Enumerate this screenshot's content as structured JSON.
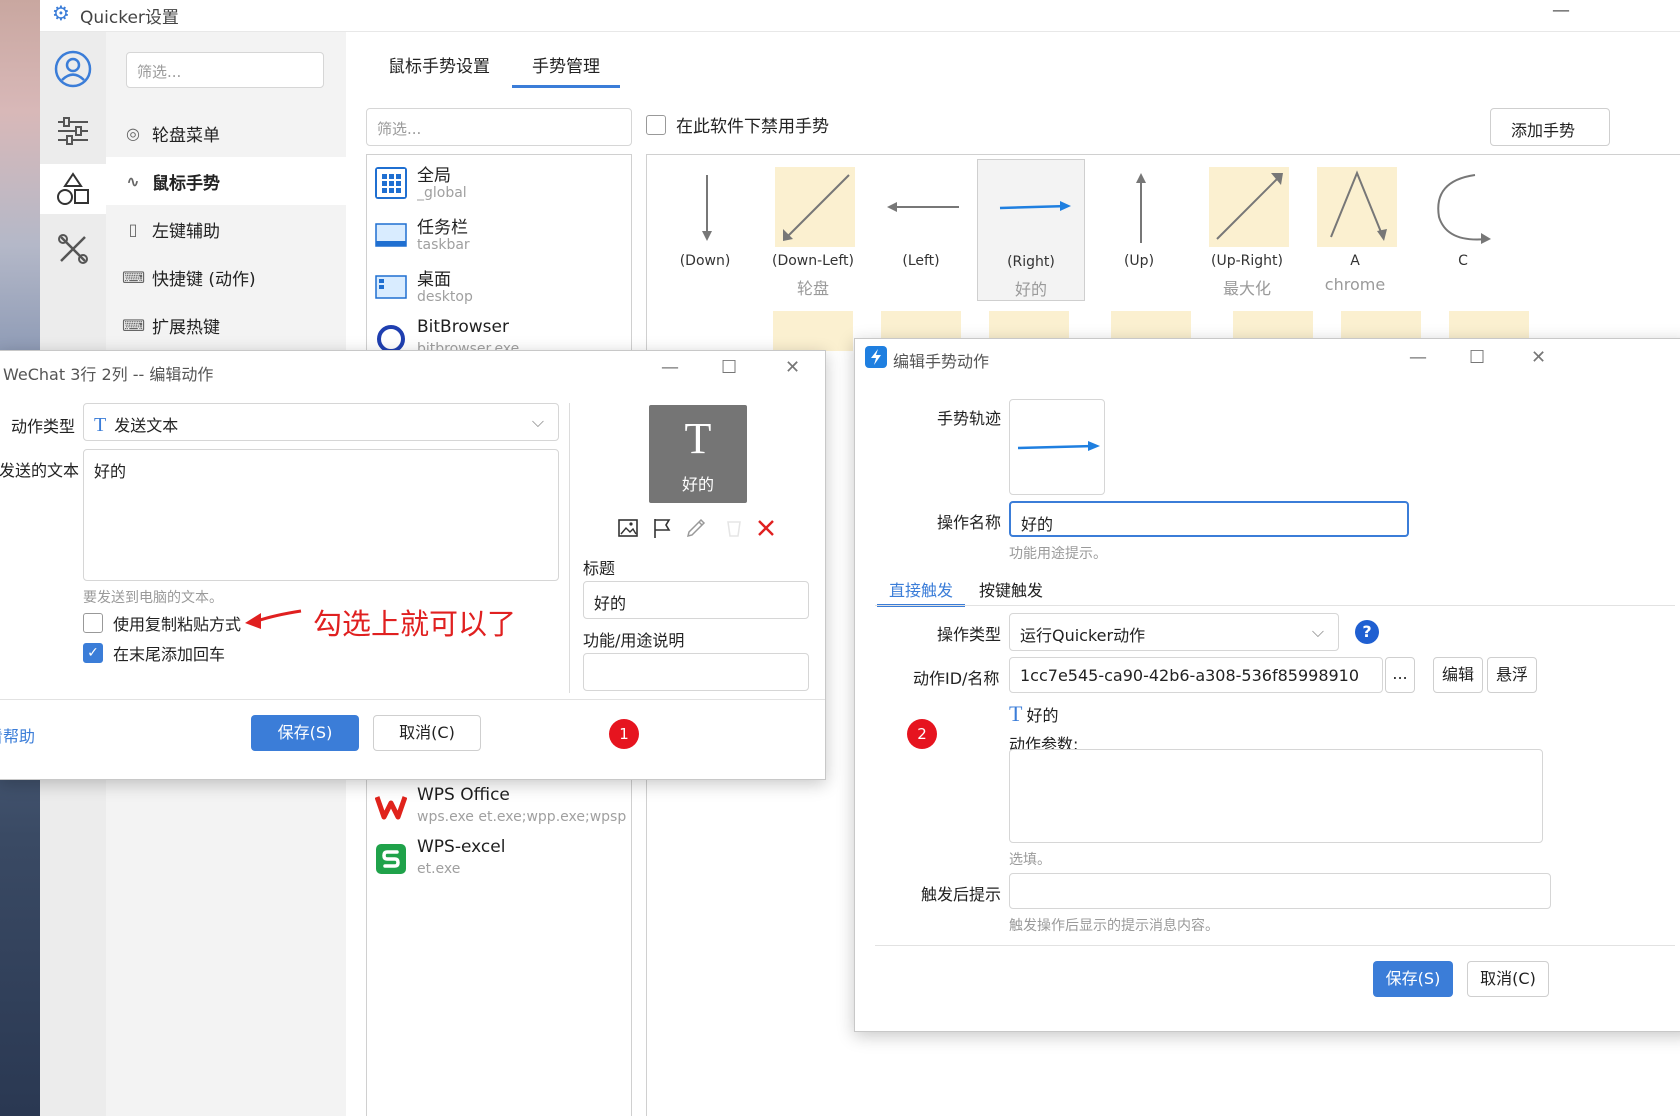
{
  "window": {
    "title": "Quicker设置",
    "minimize": "—"
  },
  "nav": {
    "filter_placeholder": "筛选...",
    "items": [
      {
        "label": "轮盘菜单",
        "icon": "wheel-icon"
      },
      {
        "label": "鼠标手势",
        "icon": "gesture-icon"
      },
      {
        "label": "左键辅助",
        "icon": "mouse-icon"
      },
      {
        "label": "快捷键 (动作)",
        "icon": "keyboard-icon"
      },
      {
        "label": "扩展热键",
        "icon": "keyboard-icon"
      }
    ]
  },
  "tabs": [
    {
      "label": "鼠标手势设置"
    },
    {
      "label": "手势管理"
    }
  ],
  "app_filter_placeholder": "筛选...",
  "disable_checkbox": "在此软件下禁用手势",
  "add_button": "添加手势",
  "apps": [
    {
      "name": "全局",
      "sub": "_global"
    },
    {
      "name": "任务栏",
      "sub": "taskbar"
    },
    {
      "name": "桌面",
      "sub": "desktop"
    },
    {
      "name": "BitBrowser",
      "sub": "bitbrowser.exe"
    },
    {
      "name": "WPS Office",
      "sub": "wps.exe  et.exe;wpp.exe;wpspdf.exe"
    },
    {
      "name": "WPS-excel",
      "sub": "et.exe"
    }
  ],
  "gestures": [
    {
      "name": "(Down)",
      "action": ""
    },
    {
      "name": "(Down-Left)",
      "action": "轮盘"
    },
    {
      "name": "(Left)",
      "action": ""
    },
    {
      "name": "(Right)",
      "action": "好的"
    },
    {
      "name": "(Up)",
      "action": ""
    },
    {
      "name": "(Up-Right)",
      "action": "最大化"
    },
    {
      "name": "A",
      "action": "chrome"
    },
    {
      "name": "C",
      "action": ""
    }
  ],
  "dialog1": {
    "title": "WeChat 3行 2列 -- 编辑动作",
    "action_type_label": "动作类型",
    "action_type_value": "发送文本",
    "send_text_label": "发送的文本",
    "send_text_value": "好的",
    "send_text_hint": "要发送到电脑的文本。",
    "copy_paste_label": "使用复制粘贴方式",
    "add_enter_label": "在末尾添加回车",
    "annotation": "勾选上就可以了",
    "preview_glyph": "T",
    "preview_caption": "好的",
    "title_label": "标题",
    "title_value": "好的",
    "desc_label": "功能/用途说明",
    "desc_value": "",
    "help_link": "看帮助",
    "save_button": "保存(S)",
    "cancel_button": "取消(C)",
    "badge": "1"
  },
  "dialog2": {
    "title": "编辑手势动作",
    "trace_label": "手势轨迹",
    "op_name_label": "操作名称",
    "op_name_value": "好的",
    "op_name_hint": "功能用途提示。",
    "tabs": [
      {
        "label": "直接触发"
      },
      {
        "label": "按键触发"
      }
    ],
    "op_type_label": "操作类型",
    "op_type_value": "运行Quicker动作",
    "action_id_label": "动作ID/名称",
    "action_id_value": "1cc7e545-ca90-42b6-a308-536f85998910",
    "more_button": "...",
    "edit_button": "编辑",
    "float_button": "悬浮",
    "action_ref_glyph": "T",
    "action_ref_label": "好的",
    "params_label": "动作参数:",
    "params_value": "",
    "params_hint": "选填。",
    "notify_label": "触发后提示",
    "notify_value": "",
    "notify_hint": "触发操作后显示的提示消息内容。",
    "save_button": "保存(S)",
    "cancel_button": "取消(C)",
    "badge": "2"
  },
  "colors": {
    "accent": "#3b7dd8",
    "annotation": "#e02020",
    "badge": "#e6141f",
    "tile": "#fbf0d0"
  }
}
